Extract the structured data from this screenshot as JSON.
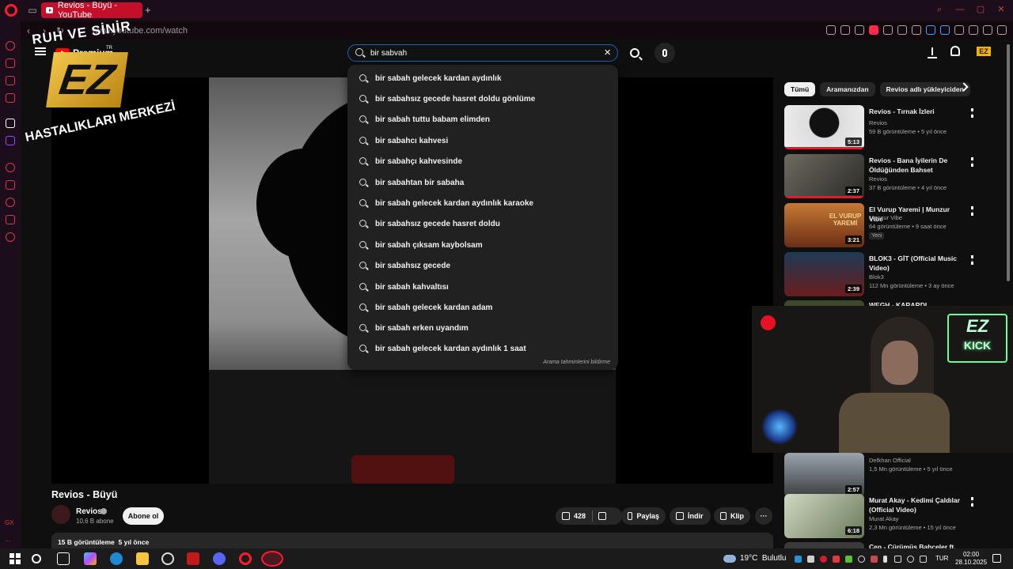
{
  "browser": {
    "tab_title": "Revios - Büyü - YouTube",
    "new_tab": "+",
    "url": "www.youtube.com/watch"
  },
  "youtube": {
    "logo_text": "Premium",
    "search": {
      "value": "bir sabvah",
      "suggestions": [
        "bir sabah gelecek kardan aydınlık",
        "bir sabahsız gecede hasret doldu gönlüme",
        "bir sabah tuttu babam elimden",
        "bir sabahcı kahvesi",
        "bir sabahçı kahvesinde",
        "bir sabahtan bir sabaha",
        "bir sabah gelecek kardan aydınlık karaoke",
        "bir sabahsız gecede hasret doldu",
        "bir sabah çıksam kaybolsam",
        "bir sabahsız gecede",
        "bir sabah kahvaltısı",
        "bir sabah gelecek kardan adam",
        "bir sabah erken uyandım",
        "bir sabah gelecek kardan aydınlık 1 saat"
      ],
      "footer": "Arama tahminlerini bildirme"
    },
    "avatar_text": "EZ",
    "video": {
      "title": "Revios - Büyü",
      "channel": "Revios",
      "subscribers": "10,6 B abone",
      "subscribe_label": "Abone ol",
      "likes": "428",
      "share_label": "Paylaş",
      "download_label": "İndir",
      "clip_label": "Klip",
      "views": "15 B görüntüleme",
      "age": "5 yıl önce"
    },
    "chips": [
      "Tümü",
      "Aramanızdan",
      "Revios adlı yükleyiciden"
    ],
    "recommendations": [
      {
        "title": "Revios - Tırnak İzleri",
        "channel": "Revios",
        "meta": "59 B görüntüleme • 5 yıl önce",
        "duration": "5:13"
      },
      {
        "title": "Revios - Bana İyilerin De Öldüğünden Bahset",
        "channel": "Revios",
        "meta": "37 B görüntüleme • 4 yıl önce",
        "duration": "2:37"
      },
      {
        "title": "El Vurup Yaremi | Munzur Vibe",
        "channel": "Munzur Vibe",
        "meta": "64 görüntüleme • 9 saat önce",
        "duration": "3:21",
        "badge": "Yeni",
        "thumb_text": "EL VURUP YAREMİ"
      },
      {
        "title": "BLOK3 - GİT (Official Music Video)",
        "channel": "Blok3",
        "meta": "112 Mn görüntüleme • 3 ay önce",
        "duration": "2:39"
      },
      {
        "title": "WEGH - KARARDI BULUTLAR",
        "channel": "",
        "meta": "",
        "duration": ""
      },
      {
        "title": "",
        "channel": "Defkhan Official",
        "meta": "1,5 Mn görüntüleme • 5 yıl önce",
        "duration": "2:57"
      },
      {
        "title": "Murat Akay - Kedimi Çaldılar (Official Video)",
        "channel": "Murat Akay",
        "meta": "2,3 Mn görüntüleme • 15 yıl önce",
        "duration": "6:18"
      },
      {
        "title": "Cen - Çürümüş Bahçeler ft.",
        "channel": "",
        "meta": "",
        "duration": ""
      }
    ]
  },
  "overlay": {
    "watermark_top": "RUH VE SİNİR",
    "watermark_bottom": "HASTALIKLARI MERKEZİ",
    "watermark_logo": "EZ",
    "watermark_tr": "TR",
    "neon_logo": "EZ",
    "neon_text": "KICK"
  },
  "taskbar": {
    "weather": "19°C",
    "weather_desc": "Bulutlu",
    "lang": "TUR",
    "time": "02:00",
    "date": "28.10.2025"
  },
  "colors": {
    "accent": "#c40f2b",
    "opera_red": "#ff1b2d",
    "youtube_red": "#ff0000",
    "search_border": "#1c62b9"
  }
}
